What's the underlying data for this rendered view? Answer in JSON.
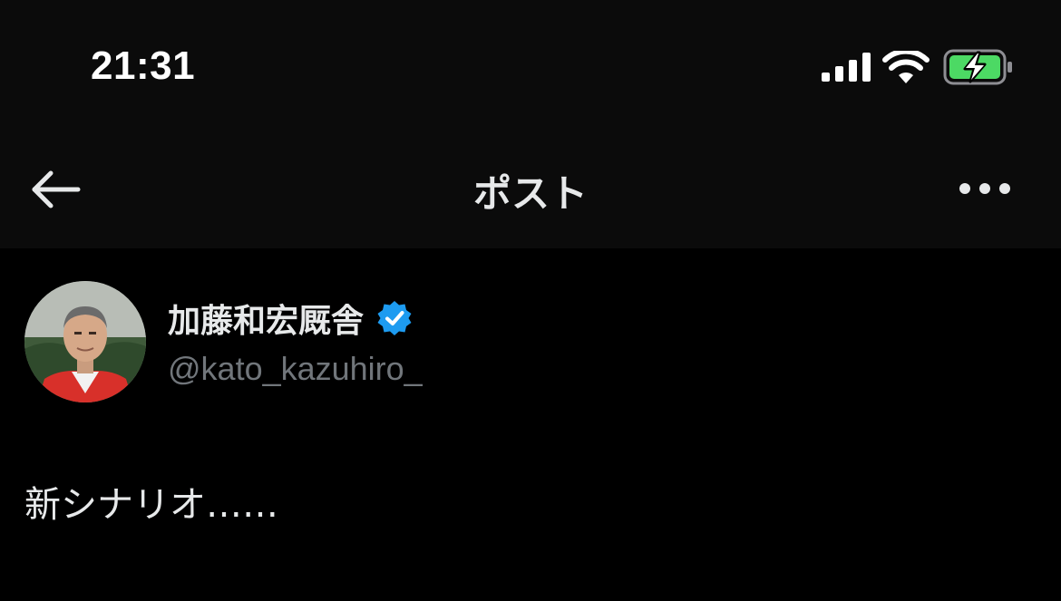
{
  "status_bar": {
    "time": "21:31",
    "icons": [
      "cellular-signal-icon",
      "wifi-icon",
      "battery-charging-icon"
    ],
    "battery_color": "#4cd964"
  },
  "nav": {
    "title": "ポスト",
    "back_icon": "arrow-left-icon",
    "more_icon": "more-horizontal-icon"
  },
  "post": {
    "author": {
      "display_name": "加藤和宏厩舎",
      "handle": "@kato_kazuhiro_",
      "verified": true,
      "verified_color": "#1d9bf0"
    },
    "text": "新シナリオ……"
  },
  "colors": {
    "background": "#000000",
    "bar_background": "#0b0b0b",
    "primary_text": "#e7e9ea",
    "secondary_text": "#71767b"
  }
}
